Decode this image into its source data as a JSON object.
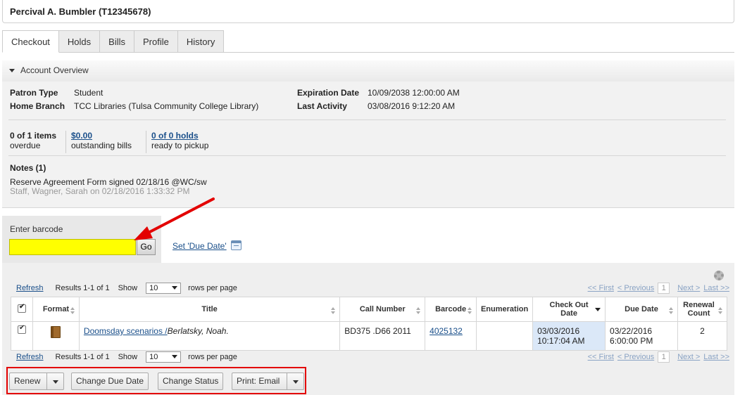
{
  "patron": {
    "name": "Percival A. Bumbler (T12345678)"
  },
  "tabs": [
    "Checkout",
    "Holds",
    "Bills",
    "Profile",
    "History"
  ],
  "overview": {
    "title": "Account Overview",
    "patron_type_label": "Patron Type",
    "patron_type": "Student",
    "home_branch_label": "Home Branch",
    "home_branch": "TCC Libraries (Tulsa Community College Library)",
    "expiration_label": "Expiration Date",
    "expiration": "10/09/2038 12:00:00 AM",
    "last_activity_label": "Last Activity",
    "last_activity": "03/08/2016 9:12:20 AM",
    "overdue_count": "0 of 1 items",
    "overdue_label": "overdue",
    "bills_amount": "$0.00",
    "bills_label": "outstanding bills",
    "holds_count": "0 of 0 holds",
    "holds_label": "ready to pickup",
    "notes_title": "Notes (1)",
    "note_text": "Reserve Agreement Form signed 02/18/16 @WC/sw",
    "note_meta": "Staff, Wagner, Sarah on 02/18/2016 1:33:32 PM"
  },
  "checkout_entry": {
    "label": "Enter barcode",
    "value": "",
    "go_label": "Go",
    "set_due_date": "Set 'Due Date'"
  },
  "pager": {
    "refresh": "Refresh",
    "results": "Results 1-1 of 1",
    "show": "Show",
    "rows": "10",
    "rows_per_page": "rows per page",
    "first": "<< First",
    "previous": "< Previous",
    "page": "1",
    "next": "Next >",
    "last": "Last >>"
  },
  "table": {
    "headers": {
      "format": "Format",
      "title": "Title",
      "call_number": "Call Number",
      "barcode": "Barcode",
      "enumeration": "Enumeration",
      "check_out_date": "Check Out Date",
      "due_date": "Due Date",
      "renewal_count": "Renewal Count"
    },
    "rows": [
      {
        "title": "Doomsday scenarios /",
        "author": "Berlatsky, Noah.",
        "call_number": "BD375 .D66 2011",
        "barcode": "4025132",
        "enumeration": "",
        "check_out_date": "03/03/2016",
        "check_out_time": "10:17:04 AM",
        "due_date": "03/22/2016",
        "due_time": "6:00:00 PM",
        "renewal_count": "2"
      }
    ]
  },
  "actions": {
    "renew": "Renew",
    "change_due_date": "Change Due Date",
    "change_status": "Change Status",
    "print_email": "Print: Email"
  },
  "colors": {
    "barcode_highlight": "#ffff00",
    "annotation_red": "#e30000",
    "link": "#1a4f8a"
  }
}
